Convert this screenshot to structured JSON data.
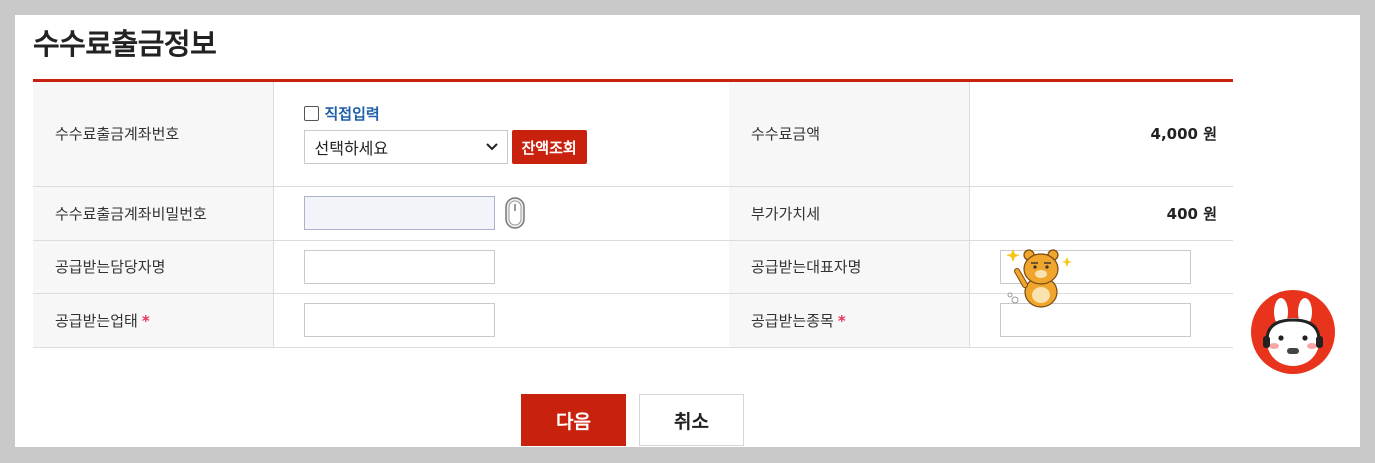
{
  "page": {
    "title": "수수료출금정보"
  },
  "form": {
    "row1": {
      "label": "수수료출금계좌번호",
      "checkbox_label": "직접입력",
      "select_value": "선택하세요",
      "balance_button": "잔액조회",
      "right_label": "수수료금액",
      "right_value": "4,000 원"
    },
    "row2": {
      "label": "수수료출금계좌비밀번호",
      "right_label": "부가가치세",
      "right_value": "400 원"
    },
    "row3": {
      "label": "공급받는담당자명",
      "right_label": "공급받는대표자명"
    },
    "row4": {
      "label": "공급받는업태",
      "required_mark": "*",
      "right_label": "공급받는종목",
      "right_required_mark": "*"
    }
  },
  "buttons": {
    "next": "다음",
    "cancel": "취소"
  },
  "colors": {
    "accent": "#c8220f",
    "link": "#1e5fa8",
    "required": "#e8335b"
  },
  "icons": [
    "chevron-down-icon",
    "mouse-icon",
    "character-sticker-icon",
    "chatbot-icon"
  ]
}
